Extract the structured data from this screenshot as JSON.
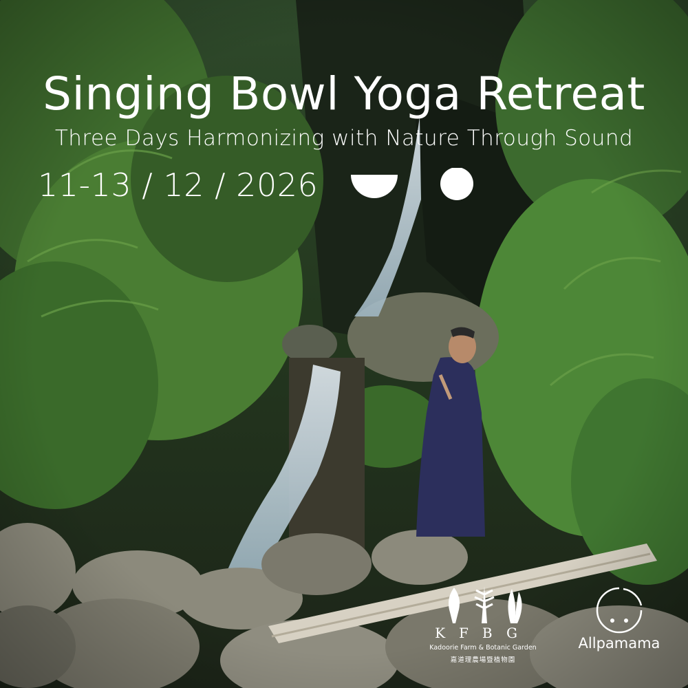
{
  "poster": {
    "title": "Singing Bowl Yoga Retreat",
    "subtitle": "Three Days Harmonizing with Nature Through Sound",
    "date": "11-13 / 12 / 2026",
    "text_color": "#ffffff",
    "logo_mark_icons": [
      "half-circle-bowl-icon",
      "full-circle-icon"
    ]
  },
  "logos": {
    "kfbg": {
      "letters": "KFBG",
      "name_en": "Kadoorie Farm & Botanic Garden",
      "name_zh": "嘉道理農場暨植物園"
    },
    "allpamama": {
      "name": "Allpamama",
      "icon": "circle-dots-icon"
    }
  },
  "scene": {
    "description_icons": [
      "waterfall",
      "mossy-rocks",
      "fallen-log",
      "robed-person-praying",
      "ferns"
    ]
  }
}
